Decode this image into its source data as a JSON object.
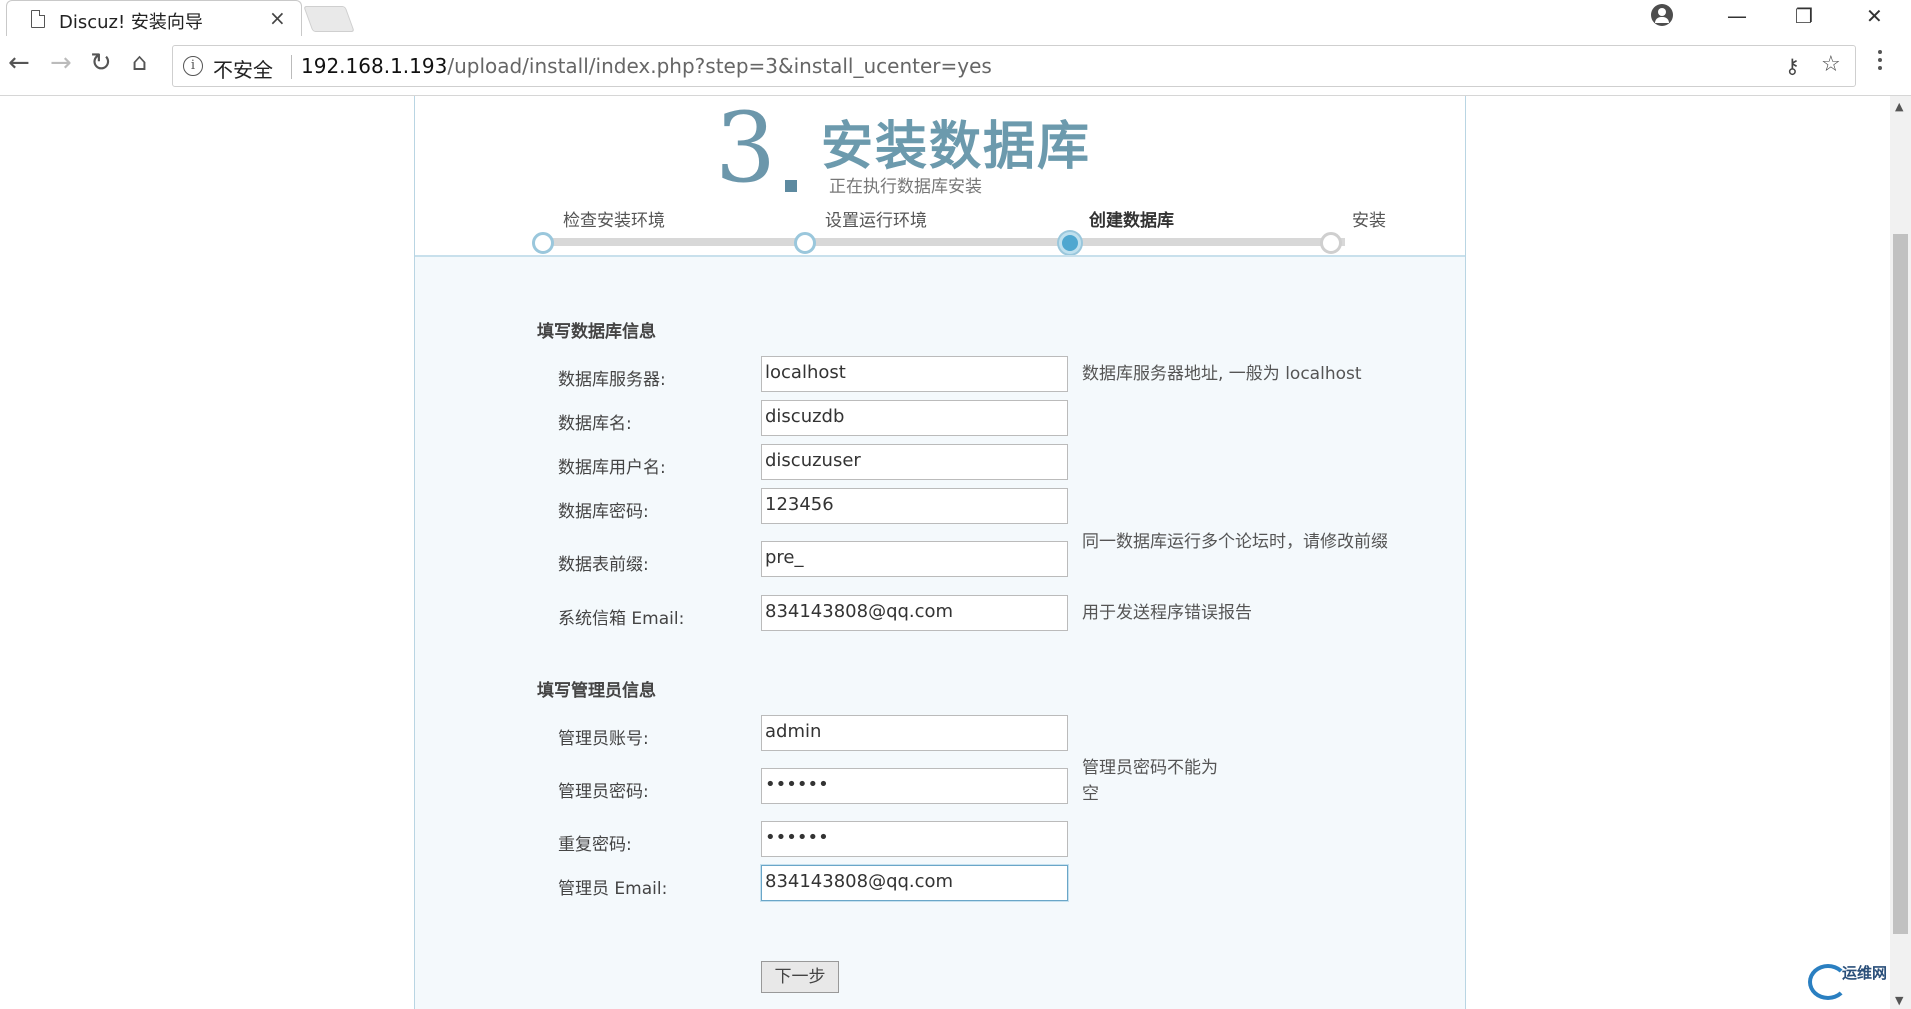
{
  "browser": {
    "tab_title": "Discuz! 安装向导",
    "tab_close": "×",
    "security_label": "不安全",
    "url_host": "192.168.1.193",
    "url_path": "/upload/install/index.php?step=3&install_ucenter=yes"
  },
  "header": {
    "step_number": "3",
    "title": "安装数据库",
    "subtitle": "正在执行数据库安装"
  },
  "progress": {
    "steps": [
      "检查安装环境",
      "设置运行环境",
      "创建数据库",
      "安装"
    ],
    "active_index": 2
  },
  "db_section": {
    "title": "填写数据库信息",
    "fields": [
      {
        "label": "数据库服务器:",
        "value": "localhost",
        "hint": "数据库服务器地址, 一般为 localhost"
      },
      {
        "label": "数据库名:",
        "value": "discuzdb",
        "hint": ""
      },
      {
        "label": "数据库用户名:",
        "value": "discuzuser",
        "hint": ""
      },
      {
        "label": "数据库密码:",
        "value": "123456",
        "hint": ""
      },
      {
        "label": "数据表前缀:",
        "value": "pre_",
        "hint": "同一数据库运行多个论坛时，请修改前缀"
      },
      {
        "label": "系统信箱 Email:",
        "value": "834143808@qq.com",
        "hint": "用于发送程序错误报告"
      }
    ]
  },
  "admin_section": {
    "title": "填写管理员信息",
    "fields": [
      {
        "label": "管理员账号:",
        "value": "admin",
        "hint": ""
      },
      {
        "label": "管理员密码:",
        "value": "••••••",
        "hint": "管理员密码不能为空"
      },
      {
        "label": "重复密码:",
        "value": "••••••",
        "hint": ""
      },
      {
        "label": "管理员 Email:",
        "value": "834143808@qq.com",
        "hint": ""
      }
    ]
  },
  "actions": {
    "next_label": "下一步"
  },
  "watermark": {
    "text": "运维网"
  },
  "colors": {
    "accent": "#6c9aad",
    "panel_bg": "#f4f9fc",
    "active_node": "#4fa7d0"
  }
}
